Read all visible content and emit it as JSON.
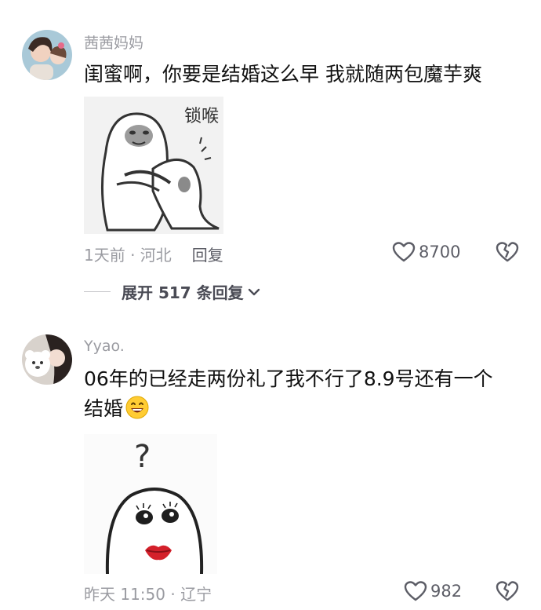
{
  "comments": [
    {
      "username": "茜茜妈妈",
      "text": "闺蜜啊，你要是结婚这么早 我就随两包魔芋爽",
      "sticker_text": "锁喉",
      "time_location": "1天前 · 河北",
      "reply_label": "回复",
      "likes": "8700",
      "expand_label": "展开 517 条回复"
    },
    {
      "username": "Yyao.",
      "text": "06年的已经走两份礼了我不行了8.9号还有一个结婚",
      "sticker_text": "?",
      "time_location": "昨天 11:50 · 辽宁",
      "likes": "982"
    }
  ],
  "icons": {
    "heart": "heart-outline-icon",
    "dislike": "broken-heart-icon",
    "chevron": "chevron-down-icon",
    "emoji": "grinning-face-emoji"
  },
  "colors": {
    "username": "#9a9ba1",
    "text": "#111111",
    "meta": "#9a9ba1"
  }
}
